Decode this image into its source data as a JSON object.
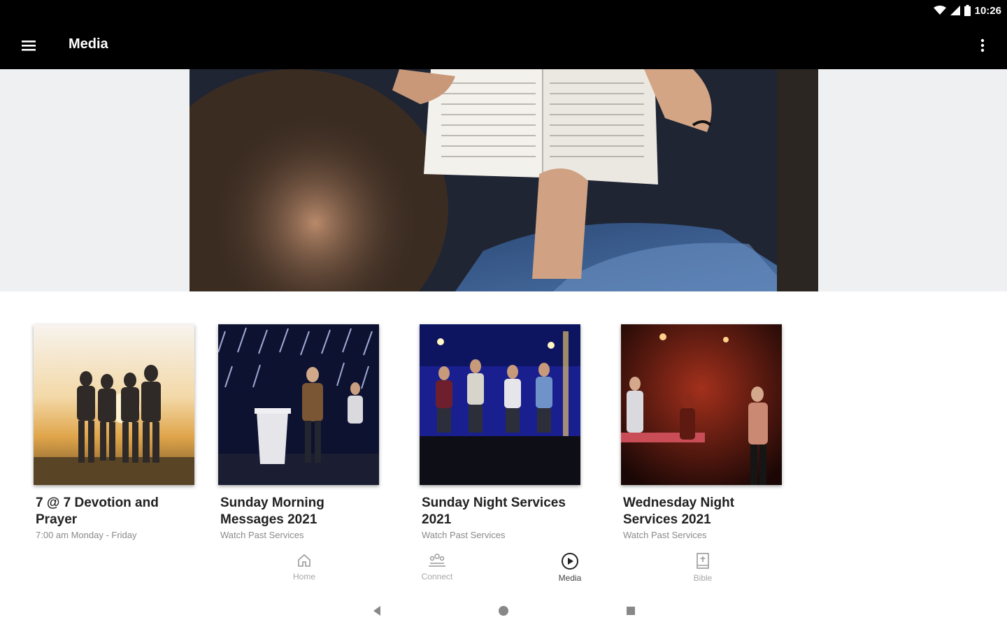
{
  "status_bar": {
    "time": "10:26"
  },
  "app_bar": {
    "title": "Media",
    "menu_icon": "menu-icon",
    "overflow_icon": "more-vert-icon"
  },
  "hero": {
    "description_icon": "open-bible-photo"
  },
  "cards": [
    {
      "title": "7 @ 7 Devotion and Prayer",
      "subtitle": "7:00 am Monday - Friday"
    },
    {
      "title": "Sunday Morning Messages 2021",
      "subtitle": "Watch Past Services"
    },
    {
      "title": "Sunday Night Services 2021",
      "subtitle": "Watch Past Services"
    },
    {
      "title": "Wednesday Night Services 2021",
      "subtitle": "Watch Past Services"
    }
  ],
  "bottom_nav": [
    {
      "label": "Home",
      "icon": "home-icon"
    },
    {
      "label": "Connect",
      "icon": "people-icon"
    },
    {
      "label": "Media",
      "icon": "play-circle-icon",
      "active": true
    },
    {
      "label": "Bible",
      "icon": "bible-icon"
    }
  ],
  "colors": {
    "app_bar": "#000000",
    "hero_band": "#eff0f2",
    "text_primary": "#212121",
    "text_secondary": "#8a8a8a"
  }
}
